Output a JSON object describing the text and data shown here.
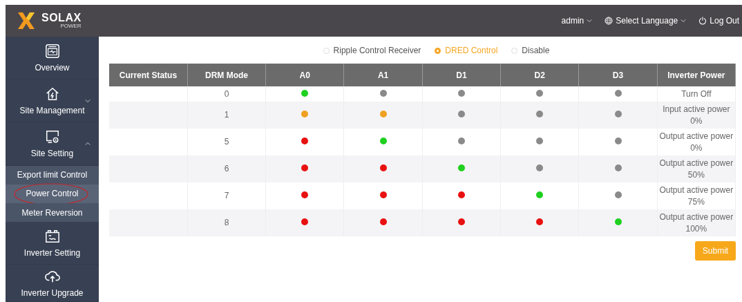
{
  "header": {
    "logo": {
      "name": "SOLAX",
      "sub": "POWER"
    },
    "user": "admin",
    "language": "Select Language",
    "logout": "Log Out"
  },
  "sidebar": {
    "items": [
      {
        "label": "Overview",
        "kind": "overview"
      },
      {
        "label": "Site Management",
        "kind": "house",
        "expanded": false
      },
      {
        "label": "Site Setting",
        "kind": "setting",
        "expanded": true,
        "children": [
          {
            "label": "Export limit Control",
            "selected": false,
            "circled": false
          },
          {
            "label": "Power Control",
            "selected": true,
            "circled": true
          },
          {
            "label": "Meter Reversion",
            "selected": false,
            "circled": false
          }
        ]
      },
      {
        "label": "Inverter Setting",
        "kind": "battery"
      },
      {
        "label": "Inverter Upgrade",
        "kind": "cloud"
      }
    ]
  },
  "mode_options": [
    {
      "label": "Ripple Control Receiver",
      "selected": false
    },
    {
      "label": "DRED Control",
      "selected": true
    },
    {
      "label": "Disable",
      "selected": false
    }
  ],
  "table": {
    "columns": [
      "Current Status",
      "DRM Mode",
      "A0",
      "A1",
      "D1",
      "D2",
      "D3",
      "Inverter Power"
    ],
    "rows": [
      {
        "drm_mode": "0",
        "dots": [
          {
            "color": "#1fd01f"
          },
          {
            "color": "#8a8a8a"
          },
          {
            "color": "#8a8a8a"
          },
          {
            "color": "#8a8a8a"
          },
          {
            "color": "#8a8a8a"
          }
        ],
        "power": [
          "Turn Off"
        ]
      },
      {
        "drm_mode": "1",
        "dots": [
          {
            "color": "#f0a020"
          },
          {
            "color": "#f0a020"
          },
          {
            "color": "#8a8a8a"
          },
          {
            "color": "#8a8a8a"
          },
          {
            "color": "#8a8a8a"
          }
        ],
        "power": [
          "Input active power",
          "0%"
        ]
      },
      {
        "drm_mode": "5",
        "dots": [
          {
            "color": "#e81010"
          },
          {
            "color": "#1fd01f"
          },
          {
            "color": "#8a8a8a"
          },
          {
            "color": "#8a8a8a"
          },
          {
            "color": "#8a8a8a"
          }
        ],
        "power": [
          "Output active power",
          "0%"
        ]
      },
      {
        "drm_mode": "6",
        "dots": [
          {
            "color": "#e81010"
          },
          {
            "color": "#e81010"
          },
          {
            "color": "#1fd01f"
          },
          {
            "color": "#8a8a8a"
          },
          {
            "color": "#8a8a8a"
          }
        ],
        "power": [
          "Output active power",
          "50%"
        ]
      },
      {
        "drm_mode": "7",
        "dots": [
          {
            "color": "#e81010"
          },
          {
            "color": "#e81010"
          },
          {
            "color": "#e81010"
          },
          {
            "color": "#1fd01f"
          },
          {
            "color": "#8a8a8a"
          }
        ],
        "power": [
          "Output active power",
          "75%"
        ]
      },
      {
        "drm_mode": "8",
        "dots": [
          {
            "color": "#e81010"
          },
          {
            "color": "#e81010"
          },
          {
            "color": "#e81010"
          },
          {
            "color": "#e81010"
          },
          {
            "color": "#1fd01f"
          }
        ],
        "power": [
          "Output active power",
          "100%"
        ]
      }
    ]
  },
  "submit": "Submit"
}
